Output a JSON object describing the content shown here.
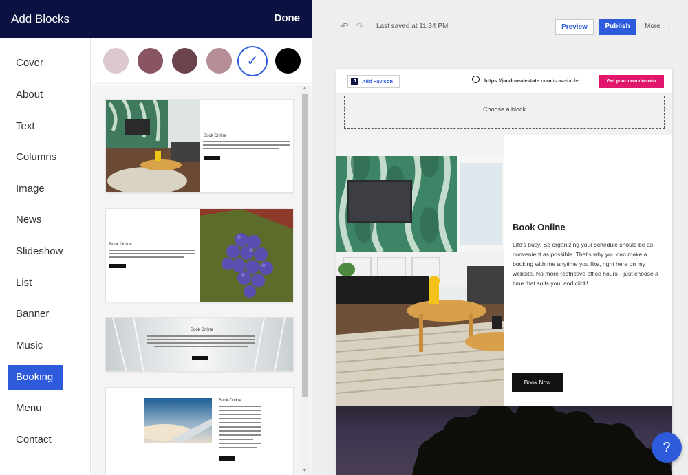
{
  "panel": {
    "title": "Add Blocks",
    "done_label": "Done"
  },
  "categories": [
    {
      "label": "Cover"
    },
    {
      "label": "About"
    },
    {
      "label": "Text"
    },
    {
      "label": "Columns"
    },
    {
      "label": "Image"
    },
    {
      "label": "News"
    },
    {
      "label": "Slideshow"
    },
    {
      "label": "List"
    },
    {
      "label": "Banner"
    },
    {
      "label": "Music"
    },
    {
      "label": "Booking",
      "active": true
    },
    {
      "label": "Menu"
    },
    {
      "label": "Contact"
    }
  ],
  "swatches": [
    {
      "color": "#dcc8cf"
    },
    {
      "color": "#8a5563"
    },
    {
      "color": "#6b434c"
    },
    {
      "color": "#b68e98"
    },
    {
      "color": "#ffffff",
      "selected": true,
      "check": "✓"
    },
    {
      "color": "#000000"
    }
  ],
  "variants": {
    "card_title": "Book Online"
  },
  "toolbar": {
    "last_saved": "Last saved at 11:34 PM",
    "preview_label": "Preview",
    "publish_label": "Publish",
    "more_label": "More",
    "undo_icon": "undo-icon",
    "redo_icon": "redo-icon"
  },
  "site_header": {
    "favicon_letter": "J",
    "favicon_label": "Add Favicon",
    "domain_url": "https://jimdorealestate.com",
    "domain_suffix": " is available!",
    "get_domain_label": "Get your own domain"
  },
  "placeholder": {
    "label": "Choose a block"
  },
  "booking": {
    "title": "Book Online",
    "description": "Life's busy. So organizing your schedule should be as convenient as possible. That's why you can make a booking with me anytime you like, right here on my website. No more restrictive office hours—just choose a time that suits you, and click!",
    "button_label": "Book Now"
  },
  "help": {
    "label": "?"
  },
  "colors": {
    "accent": "#2d5bdc",
    "header_bg": "#0b1242",
    "domain_button": "#e0176d"
  }
}
